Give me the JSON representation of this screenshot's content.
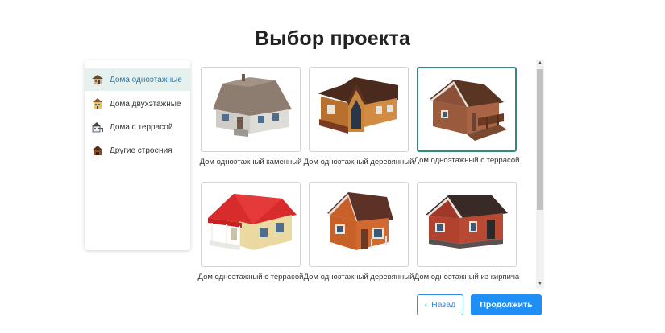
{
  "page": {
    "title": "Выбор проекта"
  },
  "sidebar": {
    "items": [
      {
        "label": "Дома одноэтажные",
        "icon": "house-one-story-icon",
        "active": true
      },
      {
        "label": "Дома двухэтажные",
        "icon": "house-two-story-icon",
        "active": false
      },
      {
        "label": "Дома с террасой",
        "icon": "house-terrace-icon",
        "active": false
      },
      {
        "label": "Другие строения",
        "icon": "other-building-icon",
        "active": false
      }
    ]
  },
  "projects": [
    {
      "caption": "Дом одноэтажный каменный",
      "selected": false
    },
    {
      "caption": "Дом одноэтажный деревянный",
      "selected": false
    },
    {
      "caption": "Дом одноэтажный с террасой",
      "selected": true
    },
    {
      "caption": "Дом одноэтажный с террасой",
      "selected": false
    },
    {
      "caption": "Дом одноэтажный деревянный",
      "selected": false
    },
    {
      "caption": "Дом одноэтажный из кирпича",
      "selected": false
    }
  ],
  "buttons": {
    "back_label": "Назад",
    "back_icon": "chevron-left-icon",
    "next_label": "Продолжить"
  },
  "colors": {
    "accent": "#1f8ef5",
    "selected_border": "#2e8b7e",
    "active_item_bg": "#e5f1ef"
  }
}
